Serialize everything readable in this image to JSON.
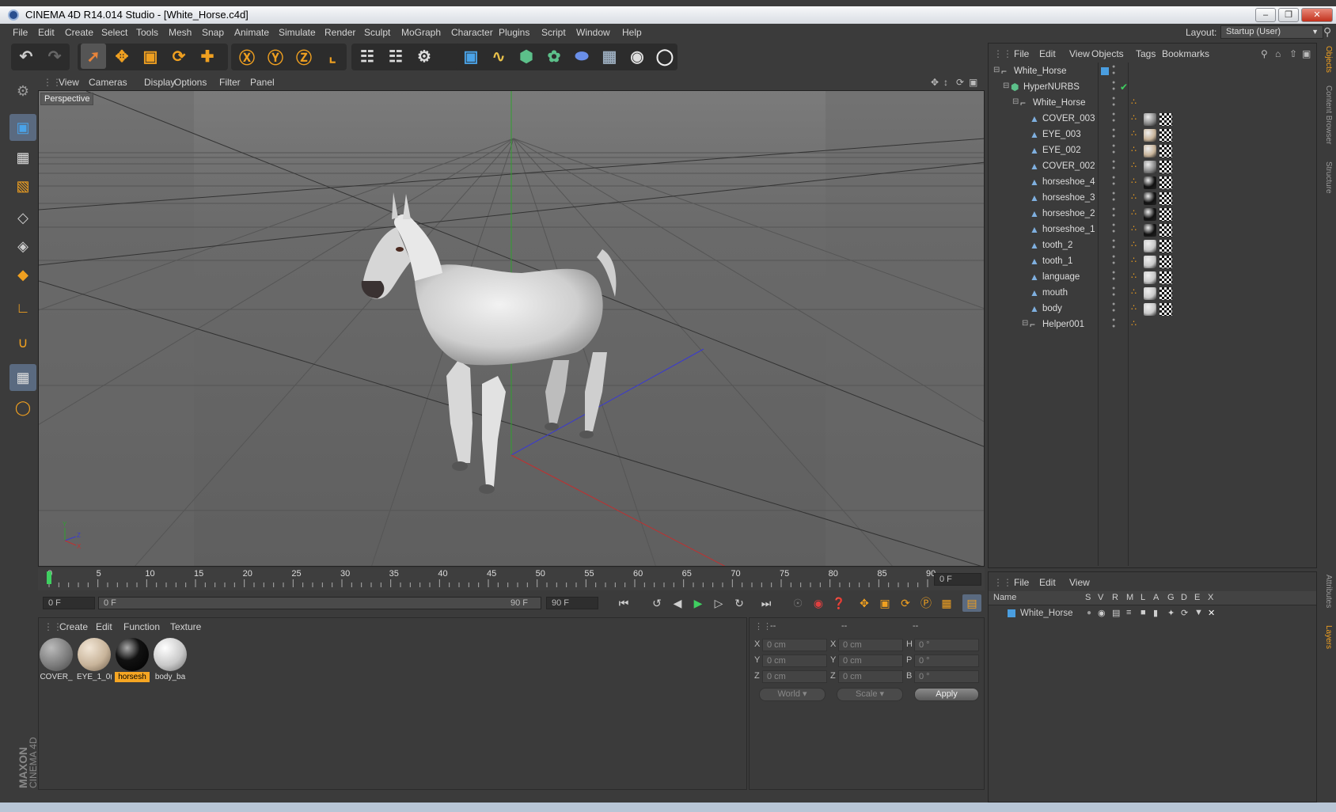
{
  "window": {
    "title": "CINEMA 4D R14.014 Studio - [White_Horse.c4d]"
  },
  "menu": [
    "File",
    "Edit",
    "Create",
    "Select",
    "Tools",
    "Mesh",
    "Snap",
    "Animate",
    "Simulate",
    "Render",
    "Sculpt",
    "MoGraph",
    "Character",
    "Plugins",
    "Script",
    "Window",
    "Help"
  ],
  "layout": {
    "label": "Layout:",
    "value": "Startup (User)"
  },
  "viewport": {
    "menu": [
      "View",
      "Cameras",
      "Display",
      "Options",
      "Filter",
      "Panel"
    ],
    "label": "Perspective"
  },
  "timeline": {
    "ticks": [
      "0",
      "5",
      "10",
      "15",
      "20",
      "25",
      "30",
      "35",
      "40",
      "45",
      "50",
      "55",
      "60",
      "65",
      "70",
      "75",
      "80",
      "85",
      "90"
    ],
    "current_frame": "0 F",
    "start_field": "0 F",
    "range_start": "0 F",
    "range_end": "90 F",
    "end_field": "90 F"
  },
  "materials": {
    "menu": [
      "Create",
      "Edit",
      "Function",
      "Texture"
    ],
    "items": [
      {
        "label": "COVER_",
        "color": "#8a8a8a"
      },
      {
        "label": "EYE_1_0(",
        "color": "#c8b49a"
      },
      {
        "label": "horsesh",
        "color": "#111111",
        "selected": true
      },
      {
        "label": "body_ba",
        "color": "#c9c9c9"
      }
    ]
  },
  "coordinates": {
    "headers": [
      "--",
      "--",
      "--"
    ],
    "rows": [
      {
        "l1": "X",
        "v1": "0 cm",
        "l2": "X",
        "v2": "0 cm",
        "l3": "H",
        "v3": "0 °"
      },
      {
        "l1": "Y",
        "v1": "0 cm",
        "l2": "Y",
        "v2": "0 cm",
        "l3": "P",
        "v3": "0 °"
      },
      {
        "l1": "Z",
        "v1": "0 cm",
        "l2": "Z",
        "v2": "0 cm",
        "l3": "B",
        "v3": "0 °"
      }
    ],
    "world": "World",
    "scale": "Scale",
    "apply": "Apply"
  },
  "brand": {
    "line1": "MAXON",
    "line2": "CINEMA 4D"
  },
  "objects": {
    "menu": [
      "File",
      "Edit",
      "View",
      "Objects",
      "Tags",
      "Bookmarks"
    ],
    "rows": [
      {
        "name": "White_Horse",
        "indent": 0,
        "kind": "null"
      },
      {
        "name": "HyperNURBS",
        "indent": 1,
        "kind": "nurbs"
      },
      {
        "name": "White_Horse",
        "indent": 2,
        "kind": "null"
      },
      {
        "name": "COVER_003",
        "indent": 3,
        "kind": "poly",
        "mat": "#8a8a8a"
      },
      {
        "name": "EYE_003",
        "indent": 3,
        "kind": "poly",
        "mat": "#c8b49a"
      },
      {
        "name": "EYE_002",
        "indent": 3,
        "kind": "poly",
        "mat": "#c8b49a"
      },
      {
        "name": "COVER_002",
        "indent": 3,
        "kind": "poly",
        "mat": "#8a8a8a"
      },
      {
        "name": "horseshoe_4",
        "indent": 3,
        "kind": "poly",
        "mat": "#111111"
      },
      {
        "name": "horseshoe_3",
        "indent": 3,
        "kind": "poly",
        "mat": "#111111"
      },
      {
        "name": "horseshoe_2",
        "indent": 3,
        "kind": "poly",
        "mat": "#111111"
      },
      {
        "name": "horseshoe_1",
        "indent": 3,
        "kind": "poly",
        "mat": "#111111"
      },
      {
        "name": "tooth_2",
        "indent": 3,
        "kind": "poly",
        "mat": "#c9c9c9"
      },
      {
        "name": "tooth_1",
        "indent": 3,
        "kind": "poly",
        "mat": "#c9c9c9"
      },
      {
        "name": "language",
        "indent": 3,
        "kind": "poly",
        "mat": "#c9c9c9"
      },
      {
        "name": "mouth",
        "indent": 3,
        "kind": "poly",
        "mat": "#c9c9c9"
      },
      {
        "name": "body",
        "indent": 3,
        "kind": "poly",
        "mat": "#c9c9c9"
      },
      {
        "name": "Helper001",
        "indent": 3,
        "kind": "null"
      }
    ]
  },
  "layers": {
    "menu": [
      "File",
      "Edit",
      "View"
    ],
    "columns": [
      "Name",
      "S",
      "V",
      "R",
      "M",
      "L",
      "A",
      "G",
      "D",
      "E",
      "X"
    ],
    "rows": [
      {
        "name": "White_Horse"
      }
    ]
  },
  "side_tabs": [
    "Objects",
    "Content Browser",
    "Structure",
    "Attributes",
    "Layers"
  ],
  "colors": {
    "accent": "#f0a020",
    "selected": "#f6a623",
    "grid": "#505050"
  }
}
